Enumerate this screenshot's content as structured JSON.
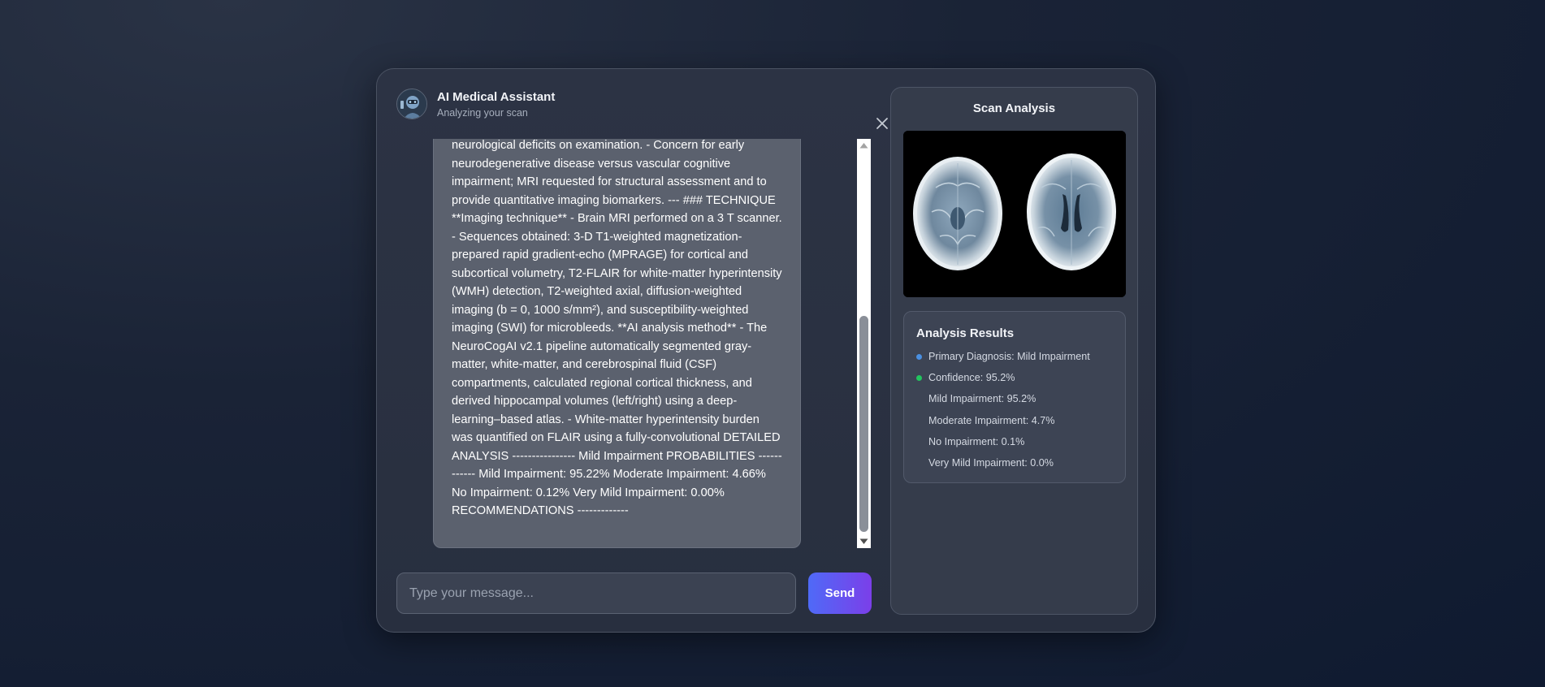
{
  "header": {
    "title": "AI Medical Assistant",
    "subtitle": "Analyzing your scan"
  },
  "message": {
    "text": "neurological deficits on examination. - Concern for early neurodegenerative disease versus vascular cognitive impairment; MRI requested for structural assessment and to provide quantitative imaging biomarkers. --- ### TECHNIQUE **Imaging technique** - Brain MRI performed on a 3 T scanner. - Sequences obtained: 3-D T1-weighted magnetization-prepared rapid gradient-echo (MPRAGE) for cortical and subcortical volumetry, T2-FLAIR for white-matter hyperintensity (WMH) detection, T2-weighted axial, diffusion-weighted imaging (b = 0, 1000 s/mm²), and susceptibility-weighted imaging (SWI) for microbleeds. **AI analysis method** - The NeuroCogAI v2.1 pipeline automatically segmented gray-matter, white-matter, and cerebrospinal fluid (CSF) compartments, calculated regional cortical thickness, and derived hippocampal volumes (left/right) using a deep-learning–based atlas. - White-matter hyperintensity burden was quantified on FLAIR using a fully-convolutional DETAILED ANALYSIS ---------------- Mild Impairment PROBABILITIES ------------ Mild Impairment: 95.22% Moderate Impairment: 4.66% No Impairment: 0.12% Very Mild Impairment: 0.00% RECOMMENDATIONS -------------"
  },
  "input": {
    "placeholder": "Type your message...",
    "send_label": "Send"
  },
  "panel": {
    "title": "Scan Analysis",
    "results_title": "Analysis Results",
    "results": [
      {
        "text": "Primary Diagnosis: Mild Impairment",
        "dot_color": "#4a90e2"
      },
      {
        "text": "Confidence: 95.2%",
        "dot_color": "#22c55e"
      },
      {
        "text": "Mild Impairment: 95.2%",
        "dot_color": ""
      },
      {
        "text": "Moderate Impairment: 4.7%",
        "dot_color": ""
      },
      {
        "text": "No Impairment: 0.1%",
        "dot_color": ""
      },
      {
        "text": "Very Mild Impairment: 0.0%",
        "dot_color": ""
      }
    ]
  },
  "colors": {
    "send_gradient_start": "#4f6af7",
    "send_gradient_end": "#7b3fe9",
    "bubble_bg": "#5b616e"
  }
}
